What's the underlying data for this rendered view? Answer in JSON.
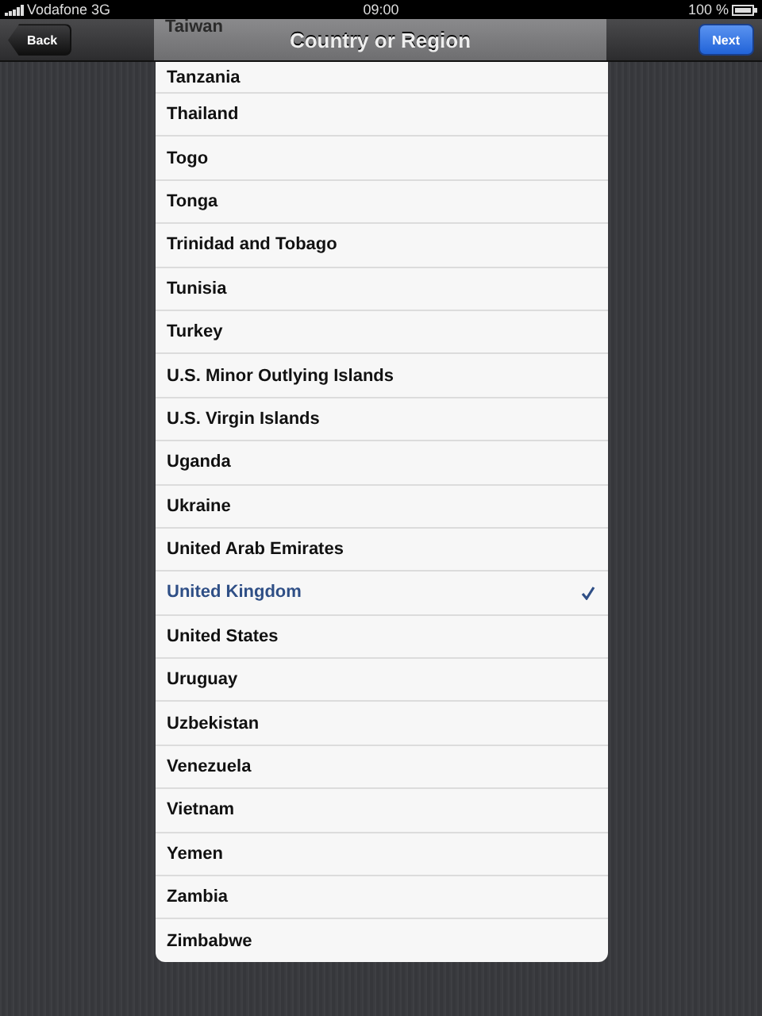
{
  "status_bar": {
    "carrier": "Vodafone 3G",
    "time": "09:00",
    "battery": "100 %"
  },
  "nav_bar": {
    "back": "Back",
    "title": "Country or Region",
    "next": "Next"
  },
  "countries": [
    {
      "name": "Taiwan",
      "selected": false
    },
    {
      "name": "Tanzania",
      "selected": false
    },
    {
      "name": "Thailand",
      "selected": false
    },
    {
      "name": "Togo",
      "selected": false
    },
    {
      "name": "Tonga",
      "selected": false
    },
    {
      "name": "Trinidad and Tobago",
      "selected": false
    },
    {
      "name": "Tunisia",
      "selected": false
    },
    {
      "name": "Turkey",
      "selected": false
    },
    {
      "name": "U.S. Minor Outlying Islands",
      "selected": false
    },
    {
      "name": "U.S. Virgin Islands",
      "selected": false
    },
    {
      "name": "Uganda",
      "selected": false
    },
    {
      "name": "Ukraine",
      "selected": false
    },
    {
      "name": "United Arab Emirates",
      "selected": false
    },
    {
      "name": "United Kingdom",
      "selected": true
    },
    {
      "name": "United States",
      "selected": false
    },
    {
      "name": "Uruguay",
      "selected": false
    },
    {
      "name": "Uzbekistan",
      "selected": false
    },
    {
      "name": "Venezuela",
      "selected": false
    },
    {
      "name": "Vietnam",
      "selected": false
    },
    {
      "name": "Yemen",
      "selected": false
    },
    {
      "name": "Zambia",
      "selected": false
    },
    {
      "name": "Zimbabwe",
      "selected": false
    }
  ]
}
